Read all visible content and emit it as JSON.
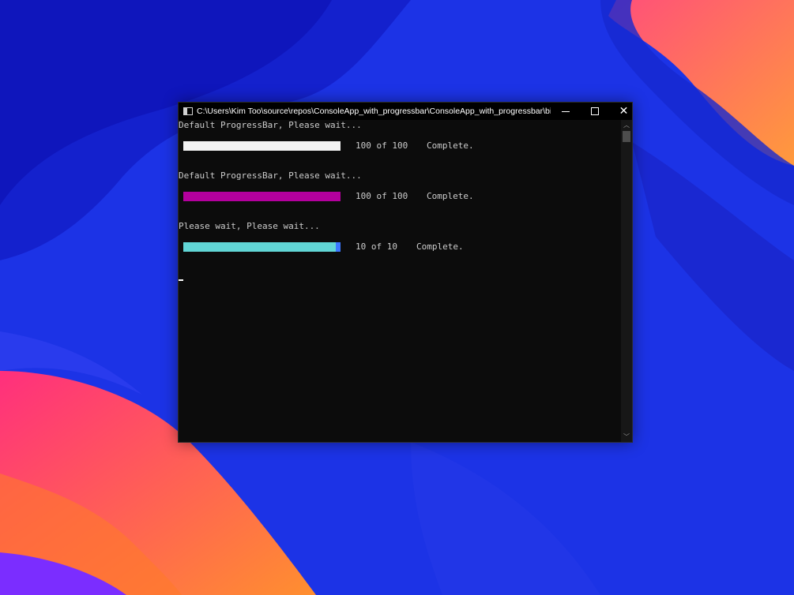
{
  "window": {
    "title": "C:\\Users\\Kim Too\\source\\repos\\ConsoleApp_with_progressbar\\ConsoleApp_with_progressbar\\bin\\De...",
    "icon": "console-app-icon",
    "minimize_icon": "minimize-icon",
    "maximize_icon": "maximize-icon",
    "close_icon": "close-icon",
    "close_glyph": "✕"
  },
  "console": {
    "sections": [
      {
        "message": "Default ProgressBar, Please wait...",
        "progress": 1.0,
        "bar_color": "#f2f2f2",
        "end_color": "#f2f2f2",
        "count": "100 of 100",
        "status": "Complete."
      },
      {
        "message": "Default ProgressBar, Please wait...",
        "progress": 1.0,
        "bar_color": "#b4009e",
        "end_color": "#b4009e",
        "count": "100 of 100",
        "status": "Complete."
      },
      {
        "message": "Please wait, Please wait...",
        "progress": 1.0,
        "bar_color": "#61d6d6",
        "end_color": "#3b78ff",
        "count": "10 of 10",
        "status": "Complete."
      }
    ],
    "text_color": "#cccccc",
    "background": "#0c0c0c"
  },
  "scrollbar": {
    "up_glyph": "︿",
    "down_glyph": "﹀"
  }
}
